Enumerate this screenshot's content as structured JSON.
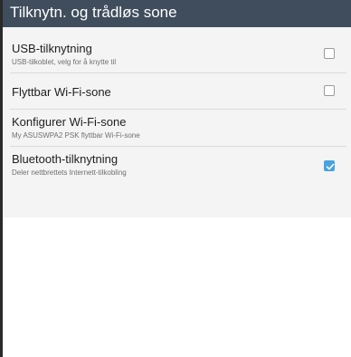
{
  "header": {
    "title": "Tilknytn. og trådløs sone"
  },
  "settings": [
    {
      "title": "USB-tilknytning",
      "subtitle": "USB-tilkoblet, velg for å knytte til",
      "checked": false
    },
    {
      "title": "Flyttbar Wi-Fi-sone",
      "checked": false
    },
    {
      "title": "Konfigurer Wi-Fi-sone",
      "subtitle": "My ASUSWPA2 PSK flyttbar Wi-Fi-sone"
    },
    {
      "title": "Bluetooth-tilknytning",
      "subtitle": "Deler nettbrettets Internett-tilkobling",
      "checked": true
    }
  ],
  "colors": {
    "header_bg": "#3f4d5c",
    "checkbox_accent": "#4aa3df"
  }
}
